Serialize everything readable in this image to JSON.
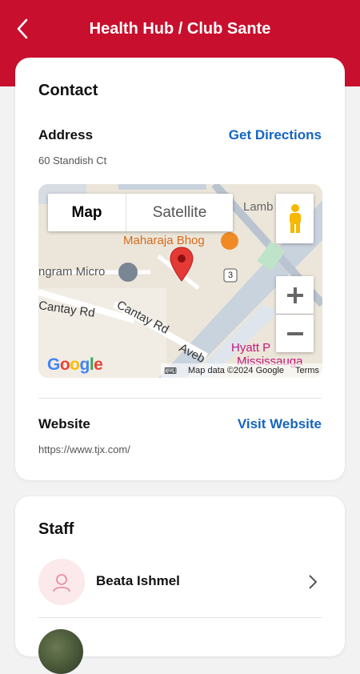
{
  "header": {
    "title": "Health Hub / Club Sante",
    "back_icon": "chevron-left-icon"
  },
  "contact": {
    "heading": "Contact",
    "address_label": "Address",
    "directions_label": "Get Directions",
    "address_value": "60 Standish Ct",
    "map": {
      "type_map": "Map",
      "type_satellite": "Satellite",
      "labels": [
        "Lamb",
        "Maharaja Bhog",
        "ngram Micro",
        "Cantay Rd",
        "Cantay Rd",
        "Aveb",
        "Hyatt P",
        "Mississauga",
        "3"
      ],
      "attribution": "Map data ©2024 Google",
      "terms": "Terms",
      "logo": "Google"
    },
    "website_label": "Website",
    "visit_label": "Visit Website",
    "website_value": "https://www.tjx.com/"
  },
  "staff": {
    "heading": "Staff",
    "members": [
      {
        "name": "Beata Ishmel"
      }
    ]
  },
  "colors": {
    "brand": "#c8102e",
    "link": "#1565c0"
  }
}
